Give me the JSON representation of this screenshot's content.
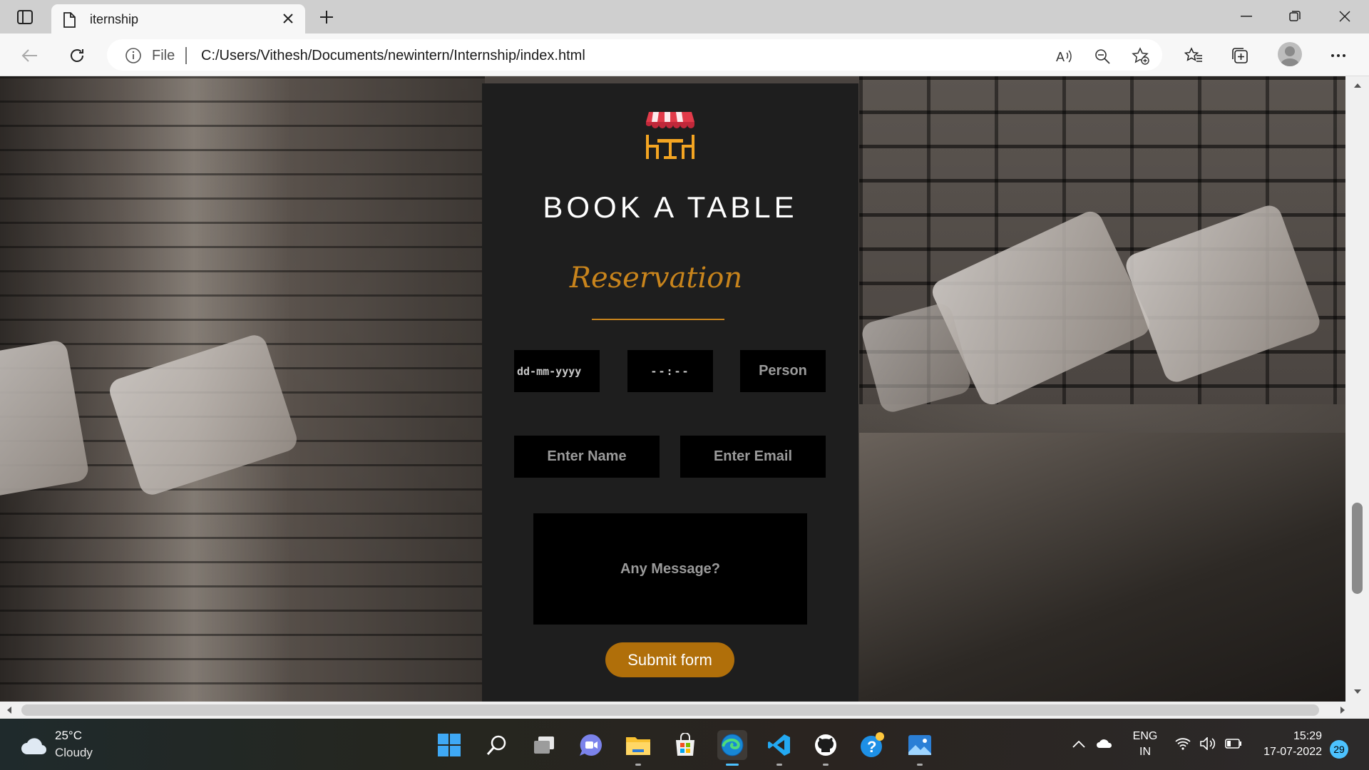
{
  "browser": {
    "tab_title": "iternship",
    "address_prefix": "File",
    "url": "C:/Users/Vithesh/Documents/newintern/Internship/index.html"
  },
  "reservation": {
    "title": "BOOK A TABLE",
    "subtitle": "Reservation",
    "date_placeholder": "dd-mm-yyyy",
    "time_placeholder": "--:--",
    "person_placeholder": "Person",
    "name_placeholder": "Enter Name",
    "email_placeholder": "Enter Email",
    "message_placeholder": "Any Message?",
    "submit_label": "Submit form"
  },
  "colors": {
    "accent": "#c8841c",
    "button": "#b06f0a",
    "card_bg": "#1e1e1e",
    "field_bg": "#000000"
  },
  "taskbar": {
    "weather_temp": "25°C",
    "weather_condition": "Cloudy",
    "language_primary": "ENG",
    "language_secondary": "IN",
    "time": "15:29",
    "date": "17-07-2022",
    "notification_count": "29",
    "apps": [
      "start-icon",
      "search-icon",
      "task-view-icon",
      "teams-chat-icon",
      "file-explorer-icon",
      "store-icon",
      "edge-icon",
      "vscode-icon",
      "github-icon",
      "help-icon",
      "photos-icon"
    ]
  }
}
